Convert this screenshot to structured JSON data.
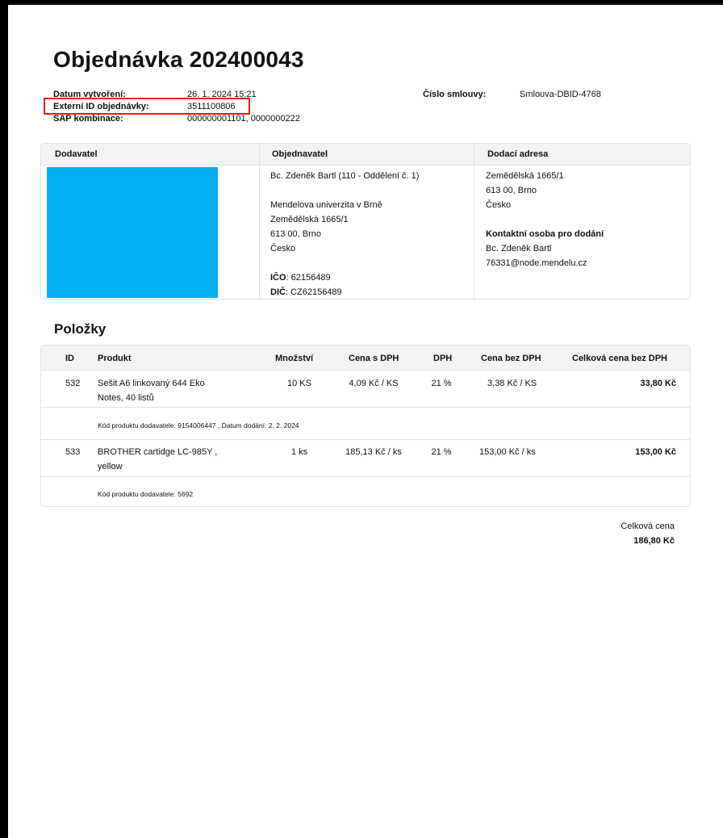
{
  "title": "Objednávka 202400043",
  "meta": {
    "created_label": "Datum vytvoření:",
    "created_value": "26. 1. 2024 15:21",
    "external_id_label": "Externí ID objednávky:",
    "external_id_value": "3511100806",
    "sap_label": "SAP kombinace:",
    "sap_value": "000000001101, 0000000222",
    "contract_label": "Číslo smlouvy:",
    "contract_value": "Smlouva-DBID-4768"
  },
  "parties": {
    "supplier_header": "Dodavatel",
    "orderer_header": "Objednavatel",
    "delivery_header": "Dodací adresa",
    "orderer_lines": [
      "Bc. Zdeněk Bartl (110 - Oddělení č. 1)",
      "",
      "Mendelova univerzita v Brně",
      "Zemědělská 1665/1",
      "613 00, Brno",
      "Česko"
    ],
    "ico_label": "IČO",
    "ico_value": ": 62156489",
    "dic_label": "DIČ",
    "dic_value": ": CZ62156489",
    "delivery_lines": [
      "Zemědělská 1665/1",
      "613 00, Brno",
      "Česko"
    ],
    "contact_label": "Kontaktní osoba pro dodání",
    "contact_name": "Bc. Zdeněk Bartl",
    "contact_email": "76331@node.mendelu.cz",
    "redaction_color": "#00b0f0"
  },
  "items": {
    "title": "Položky",
    "headers": {
      "id": "ID",
      "product": "Produkt",
      "qty": "Množství",
      "price_vat": "Cena s DPH",
      "vat": "DPH",
      "price_novat": "Cena bez DPH",
      "total_novat": "Celková cena bez DPH"
    },
    "rows": [
      {
        "id": "532",
        "product_line1": "Sešit A6 linkovaný 644 Eko",
        "product_line2": "Notes, 40 listů",
        "qty": "10 KS",
        "price_vat": "4,09 Kč / KS",
        "vat": "21 %",
        "price_novat": "3,38 Kč / KS",
        "total": "33,80 Kč",
        "note": "Kód produktu dodavatele: 9154006447 , Datum dodání: 2. 2. 2024"
      },
      {
        "id": "533",
        "product_line1": "BROTHER cartidge LC-985Y ,",
        "product_line2": "yellow",
        "qty": "1 ks",
        "price_vat": "185,13 Kč / ks",
        "vat": "21 %",
        "price_novat": "153,00 Kč / ks",
        "total": "153,00 Kč",
        "note": "Kód produktu dodavatele: 5692"
      }
    ]
  },
  "total": {
    "label": "Celková cena",
    "value": "186,80 Kč"
  },
  "colors": {
    "highlight": "#e0201c",
    "border": "#e2e2e2",
    "header_bg": "#f3f3f3"
  }
}
